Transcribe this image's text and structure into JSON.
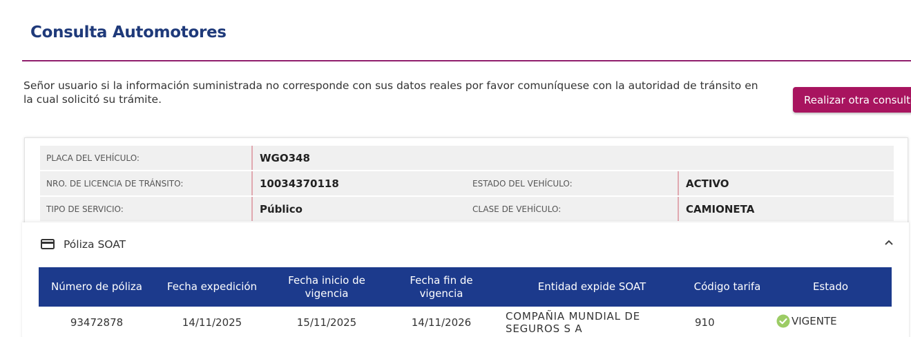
{
  "header": {
    "title": "Consulta Automotores"
  },
  "notice": {
    "text": "Señor usuario si la información suministrada no corresponde con sus datos reales por favor comuníquese con la autoridad de tránsito en la cual solicitó su trámite."
  },
  "actions": {
    "again_label": "Realizar otra consulta"
  },
  "vehicle": {
    "plate_label": "PLACA DEL VEHÍCULO:",
    "plate": "WGO348",
    "license_label": "NRO. DE LICENCIA DE TRÁNSITO:",
    "license": "10034370118",
    "status_label": "ESTADO DEL VEHÍCULO:",
    "status": "ACTIVO",
    "service_label": "TIPO DE SERVICIO:",
    "service": "Público",
    "class_label": "CLASE DE VEHÍCULO:",
    "class": "CAMIONETA"
  },
  "soat": {
    "title": "Póliza SOAT",
    "columns": [
      "Número de póliza",
      "Fecha expedición",
      "Fecha inicio de vigencia",
      "Fecha fin de vigencia",
      "Entidad expide SOAT",
      "Código tarifa",
      "Estado"
    ],
    "rows": [
      [
        "93472878",
        "14/11/2025",
        "15/11/2025",
        "14/11/2026",
        "COMPAÑIA MUNDIAL DE SEGUROS S A",
        "910",
        "VIGENTE"
      ]
    ]
  },
  "colors": {
    "title": "#1f3a7a",
    "accent": "#a8145f",
    "rule": "#8f1d6b",
    "table_header": "#1c3a8c",
    "valid": "#9ccc65"
  },
  "icons": {
    "panel": "credit-card-icon",
    "collapse": "chevron-up-icon",
    "status": "check-circle-icon"
  }
}
